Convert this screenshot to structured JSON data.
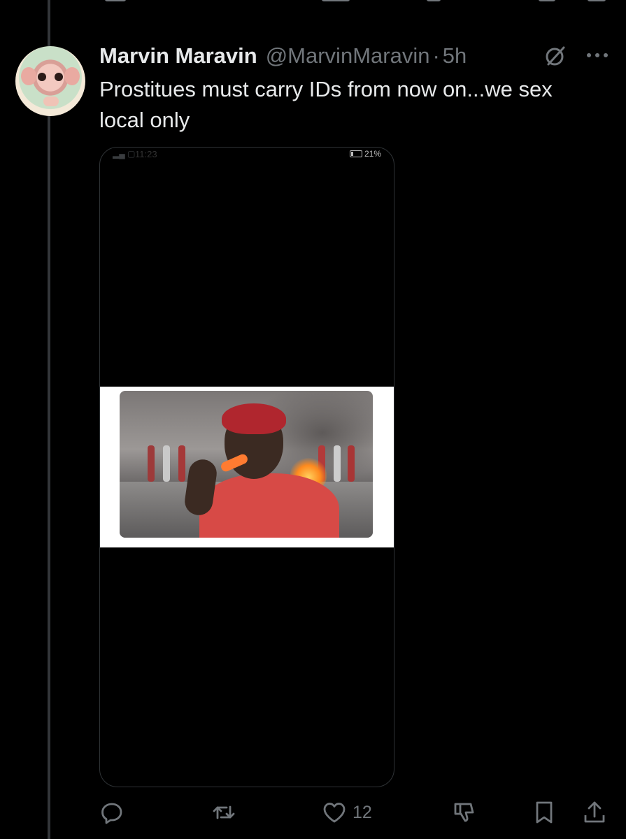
{
  "tweet": {
    "author_name": "Marvin Maravin",
    "author_handle": "@MarvinMaravin",
    "separator": "·",
    "time": "5h",
    "text": "Prostitues must carry IDs from now on...we sex local only"
  },
  "media": {
    "status_bar": {
      "time": "11:23",
      "battery": "21%"
    }
  },
  "actions": {
    "likes": "12"
  },
  "icons": {
    "reply": "reply-icon",
    "retweet": "retweet-icon",
    "like": "heart-icon",
    "dislike": "dislike-icon",
    "bookmark": "bookmark-icon",
    "share": "share-icon",
    "grok": "grok-icon",
    "more": "more-icon"
  },
  "colors": {
    "background": "#000000",
    "text": "#e7e9ea",
    "muted": "#71767b",
    "border": "#2f3336"
  }
}
